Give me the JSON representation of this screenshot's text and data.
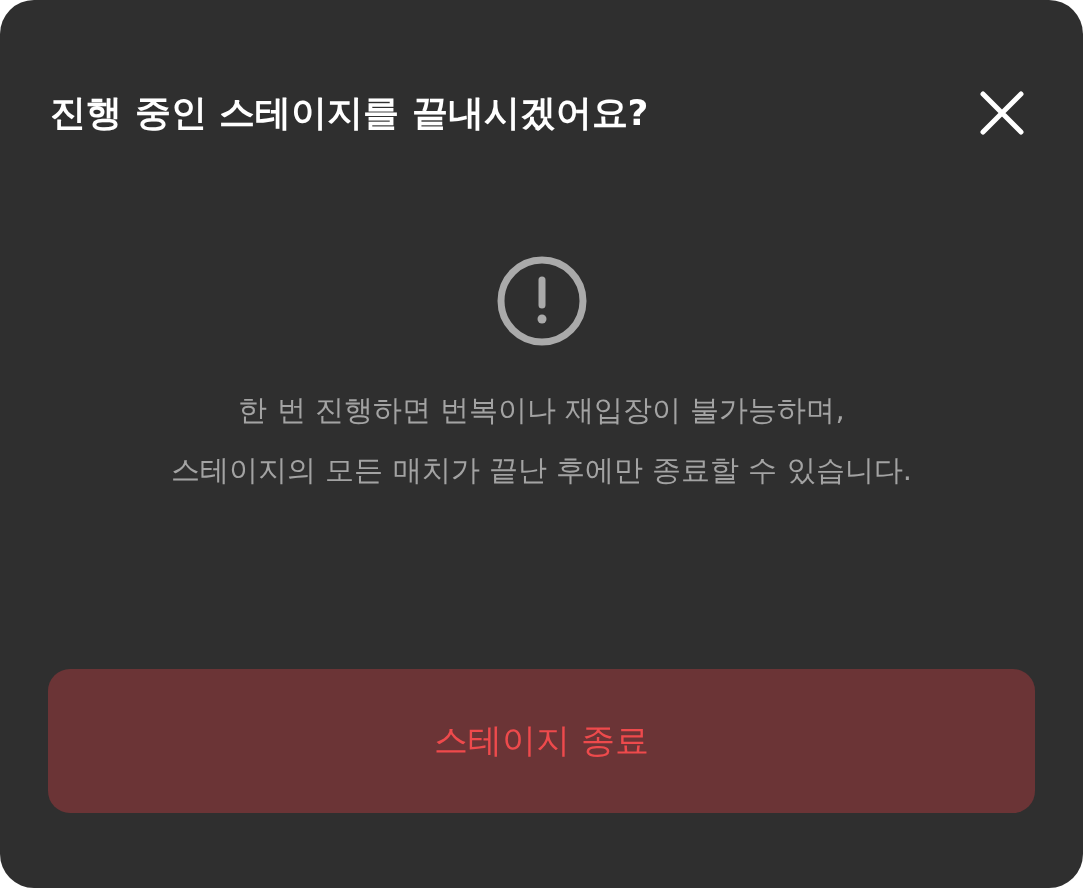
{
  "dialog": {
    "title": "진행 중인 스테이지를 끝내시겠어요?",
    "message_lines": [
      "한 번 진행하면 번복이나 재입장이 불가능하며,",
      "스테이지의 모든 매치가 끝난 후에만 종료할 수 있습니다."
    ],
    "button": "스테이지 종료"
  }
}
